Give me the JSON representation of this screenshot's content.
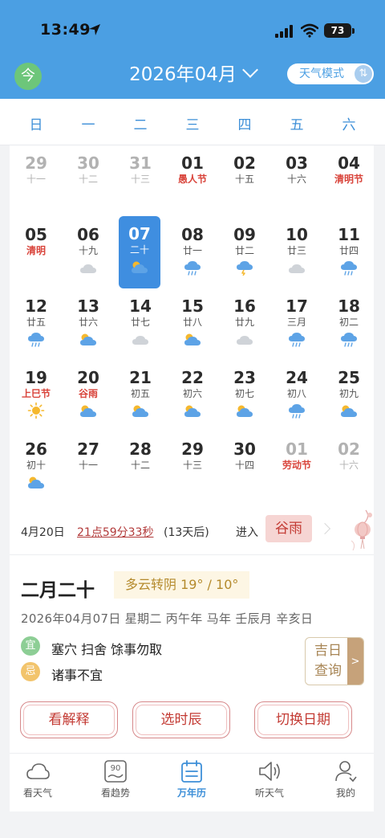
{
  "status": {
    "time": "13:49",
    "battery": "73"
  },
  "header": {
    "today_label": "今",
    "month_title": "2026年04月",
    "mode_label": "天气模式",
    "mode_toggle": "⇅"
  },
  "weekdays": [
    "日",
    "一",
    "二",
    "三",
    "四",
    "五",
    "六"
  ],
  "calendar": {
    "rows": [
      [
        {
          "day": "29",
          "lunar": "十一",
          "other": true,
          "weather": ""
        },
        {
          "day": "30",
          "lunar": "十二",
          "other": true,
          "weather": ""
        },
        {
          "day": "31",
          "lunar": "十三",
          "other": true,
          "weather": ""
        },
        {
          "day": "01",
          "lunar": "愚人节",
          "red": true,
          "weather": ""
        },
        {
          "day": "02",
          "lunar": "十五",
          "weather": ""
        },
        {
          "day": "03",
          "lunar": "十六",
          "weather": ""
        },
        {
          "day": "04",
          "lunar": "清明节",
          "red": true,
          "weather": ""
        }
      ],
      [
        {
          "day": "05",
          "lunar": "清明",
          "red": true,
          "weather": ""
        },
        {
          "day": "06",
          "lunar": "十九",
          "weather": "cloudy-icon"
        },
        {
          "day": "07",
          "lunar": "二十",
          "selected": true,
          "weather": "partly-cloudy-icon"
        },
        {
          "day": "08",
          "lunar": "廿一",
          "weather": "rain-icon"
        },
        {
          "day": "09",
          "lunar": "廿二",
          "weather": "thunderstorm-icon"
        },
        {
          "day": "10",
          "lunar": "廿三",
          "weather": "cloudy-icon"
        },
        {
          "day": "11",
          "lunar": "廿四",
          "weather": "rain-icon"
        }
      ],
      [
        {
          "day": "12",
          "lunar": "廿五",
          "weather": "rain-icon"
        },
        {
          "day": "13",
          "lunar": "廿六",
          "weather": "partly-cloudy-icon"
        },
        {
          "day": "14",
          "lunar": "廿七",
          "weather": "cloudy-icon"
        },
        {
          "day": "15",
          "lunar": "廿八",
          "weather": "partly-cloudy-icon"
        },
        {
          "day": "16",
          "lunar": "廿九",
          "weather": "cloudy-icon"
        },
        {
          "day": "17",
          "lunar": "三月",
          "weather": "rain-icon"
        },
        {
          "day": "18",
          "lunar": "初二",
          "weather": "rain-icon"
        }
      ],
      [
        {
          "day": "19",
          "lunar": "上巳节",
          "red": true,
          "weather": "sunny-icon"
        },
        {
          "day": "20",
          "lunar": "谷雨",
          "red": true,
          "weather": "partly-cloudy-icon"
        },
        {
          "day": "21",
          "lunar": "初五",
          "weather": "partly-cloudy-icon"
        },
        {
          "day": "22",
          "lunar": "初六",
          "weather": "partly-cloudy-icon"
        },
        {
          "day": "23",
          "lunar": "初七",
          "weather": "partly-cloudy-icon"
        },
        {
          "day": "24",
          "lunar": "初八",
          "weather": "rain-icon"
        },
        {
          "day": "25",
          "lunar": "初九",
          "weather": "partly-cloudy-icon"
        }
      ],
      [
        {
          "day": "26",
          "lunar": "初十",
          "weather": "partly-cloudy-icon"
        },
        {
          "day": "27",
          "lunar": "十一",
          "weather": ""
        },
        {
          "day": "28",
          "lunar": "十二",
          "weather": ""
        },
        {
          "day": "29",
          "lunar": "十三",
          "weather": ""
        },
        {
          "day": "30",
          "lunar": "十四",
          "weather": ""
        },
        {
          "day": "01",
          "lunar": "劳动节",
          "red": true,
          "other": true,
          "weather": ""
        },
        {
          "day": "02",
          "lunar": "十六",
          "other": true,
          "weather": ""
        }
      ]
    ]
  },
  "solar_term": {
    "date": "4月20日",
    "time": "21点59分33秒",
    "after": "(13天后)",
    "enter": "进入",
    "name": "谷雨"
  },
  "detail": {
    "lunar_date": "二月二十",
    "weather": "多云转阴 19° / 10°",
    "full_date": "2026年04月07日 星期二 丙午年 马年 壬辰月 辛亥日",
    "yi_label": "宜",
    "yi_text": "塞穴 扫舍 馀事勿取",
    "ji_label": "忌",
    "ji_text": "诸事不宜",
    "jiri_label": "吉日查询",
    "jiri_arrow": ">"
  },
  "actions": [
    "看解释",
    "选时辰",
    "切换日期"
  ],
  "tabs": [
    {
      "label": "看天气",
      "icon": "weather-icon"
    },
    {
      "label": "看趋势",
      "icon": "trend-icon",
      "badge": "90"
    },
    {
      "label": "万年历",
      "icon": "calendar-icon",
      "active": true
    },
    {
      "label": "听天气",
      "icon": "speaker-icon"
    },
    {
      "label": "我的",
      "icon": "profile-icon"
    }
  ]
}
